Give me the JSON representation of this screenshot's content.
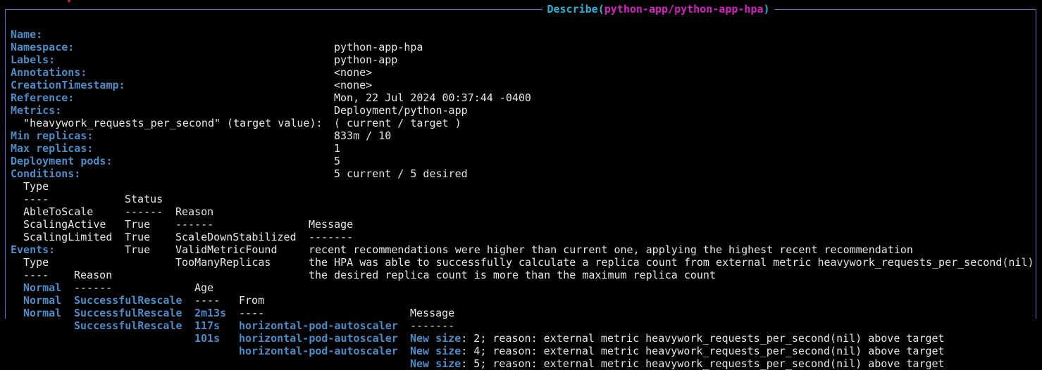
{
  "window": {
    "title_prefix": "Describe(",
    "title_resource": "python-app/python-app-hpa",
    "title_suffix": ")"
  },
  "fields": [
    {
      "key": "Name:",
      "value": "python-app-hpa"
    },
    {
      "key": "Namespace:",
      "value": "python-app"
    },
    {
      "key": "Labels:",
      "value": "<none>"
    },
    {
      "key": "Annotations:",
      "value": "<none>"
    },
    {
      "key": "CreationTimestamp:",
      "value": "Mon, 22 Jul 2024 00:37:44 -0400"
    },
    {
      "key": "Reference:",
      "value": "Deployment/python-app"
    },
    {
      "key": "Metrics:",
      "value": "( current / target )"
    }
  ],
  "metric_line": {
    "label": "  \"heavywork_requests_per_second\" (target value):",
    "value": "833m / 10"
  },
  "fields2": [
    {
      "key": "Min replicas:",
      "value": "1"
    },
    {
      "key": "Max replicas:",
      "value": "5"
    },
    {
      "key": "Deployment pods:",
      "value": "5 current / 5 desired"
    }
  ],
  "conditions": {
    "label": "Conditions:",
    "headers": [
      "Type",
      "Status",
      "Reason",
      "Message"
    ],
    "dashes": [
      "----",
      "------",
      "------",
      "-------"
    ],
    "rows": [
      [
        "AbleToScale",
        "True",
        "ScaleDownStabilized",
        "recent recommendations were higher than current one, applying the highest recent recommendation"
      ],
      [
        "ScalingActive",
        "True",
        "ValidMetricFound",
        "the HPA was able to successfully calculate a replica count from external metric heavywork_requests_per_second(nil)"
      ],
      [
        "ScalingLimited",
        "True",
        "TooManyReplicas",
        "the desired replica count is more than the maximum replica count"
      ]
    ]
  },
  "events": {
    "label": "Events:",
    "headers": [
      "Type",
      "Reason",
      "Age",
      "From",
      "Message"
    ],
    "dashes": [
      "----",
      "------",
      "----",
      "----",
      "-------"
    ],
    "rows": [
      {
        "type": "Normal",
        "reason": "SuccessfulRescale",
        "age": "2m13s",
        "from": "horizontal-pod-autoscaler",
        "msg_key": "New size",
        "msg_rest": ": 2; reason: external metric heavywork_requests_per_second(nil) above target"
      },
      {
        "type": "Normal",
        "reason": "SuccessfulRescale",
        "age": "117s",
        "from": "horizontal-pod-autoscaler",
        "msg_key": "New size",
        "msg_rest": ": 4; reason: external metric heavywork_requests_per_second(nil) above target"
      },
      {
        "type": "Normal",
        "reason": "SuccessfulRescale",
        "age": "101s",
        "from": "horizontal-pod-autoscaler",
        "msg_key": "New size",
        "msg_rest": ": 5; reason: external metric heavywork_requests_per_second(nil) above target"
      }
    ]
  },
  "colors": {
    "key": "#4b8cc7",
    "title_cyan": "#2ab3d8",
    "title_magenta": "#d620c4",
    "border": "#5a6ad8",
    "background": "#000000"
  }
}
